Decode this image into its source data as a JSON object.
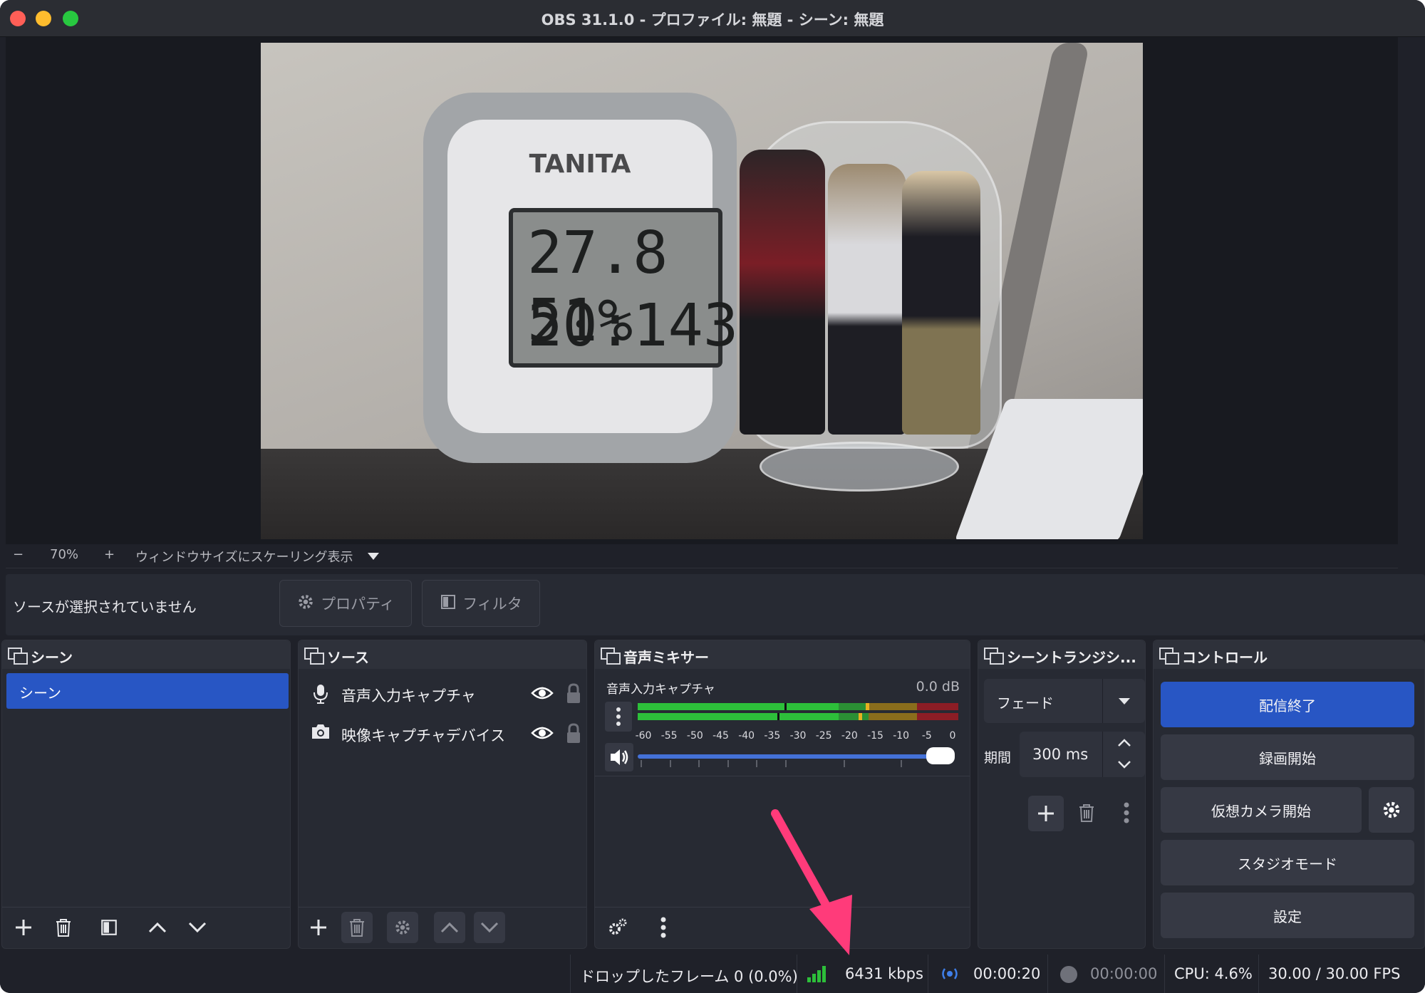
{
  "window": {
    "title": "OBS 31.1.0 - プロファイル: 無題 - シーン: 無題"
  },
  "preview": {
    "clock_brand": "TANITA",
    "lcd_top": "27.8 51%",
    "lcd_bottom": "20:1430"
  },
  "zoom": {
    "minus": "−",
    "level": "70%",
    "plus": "+",
    "scaling_mode": "ウィンドウサイズにスケーリング表示"
  },
  "toolbar": {
    "no_source": "ソースが選択されていません",
    "properties": "プロパティ",
    "filters": "フィルタ"
  },
  "scenes": {
    "title": "シーン",
    "items": [
      "シーン"
    ]
  },
  "sources": {
    "title": "ソース",
    "items": [
      {
        "label": "音声入力キャプチャ",
        "icon": "microphone-icon"
      },
      {
        "label": "映像キャプチャデバイス",
        "icon": "camera-icon"
      }
    ]
  },
  "mixer": {
    "title": "音声ミキサー",
    "channel_name": "音声入力キャプチャ",
    "level": "0.0 dB",
    "ticks": [
      "-60",
      "-55",
      "-50",
      "-45",
      "-40",
      "-35",
      "-30",
      "-25",
      "-20",
      "-15",
      "-10",
      "-5",
      "0"
    ],
    "volume": 0.98
  },
  "transitions": {
    "title": "シーントランジシ...",
    "selected": "フェード",
    "duration_label": "期間",
    "duration_value": "300 ms"
  },
  "controls": {
    "title": "コントロール",
    "stop_stream": "配信終了",
    "start_record": "録画開始",
    "start_vcam": "仮想カメラ開始",
    "studio_mode": "スタジオモード",
    "settings": "設定"
  },
  "status": {
    "dropped": "ドロップしたフレーム 0 (0.0%)",
    "bitrate": "6431 kbps",
    "stream_time": "00:00:20",
    "record_time": "00:00:00",
    "cpu": "CPU: 4.6%",
    "fps": "30.00 / 30.00 FPS"
  },
  "colors": {
    "accent": "#2856c4",
    "annotation_arrow": "#ff3b7a",
    "meter_green": "#2dbf3a",
    "meter_yellow": "#c8a020",
    "meter_red": "#b3202a"
  }
}
